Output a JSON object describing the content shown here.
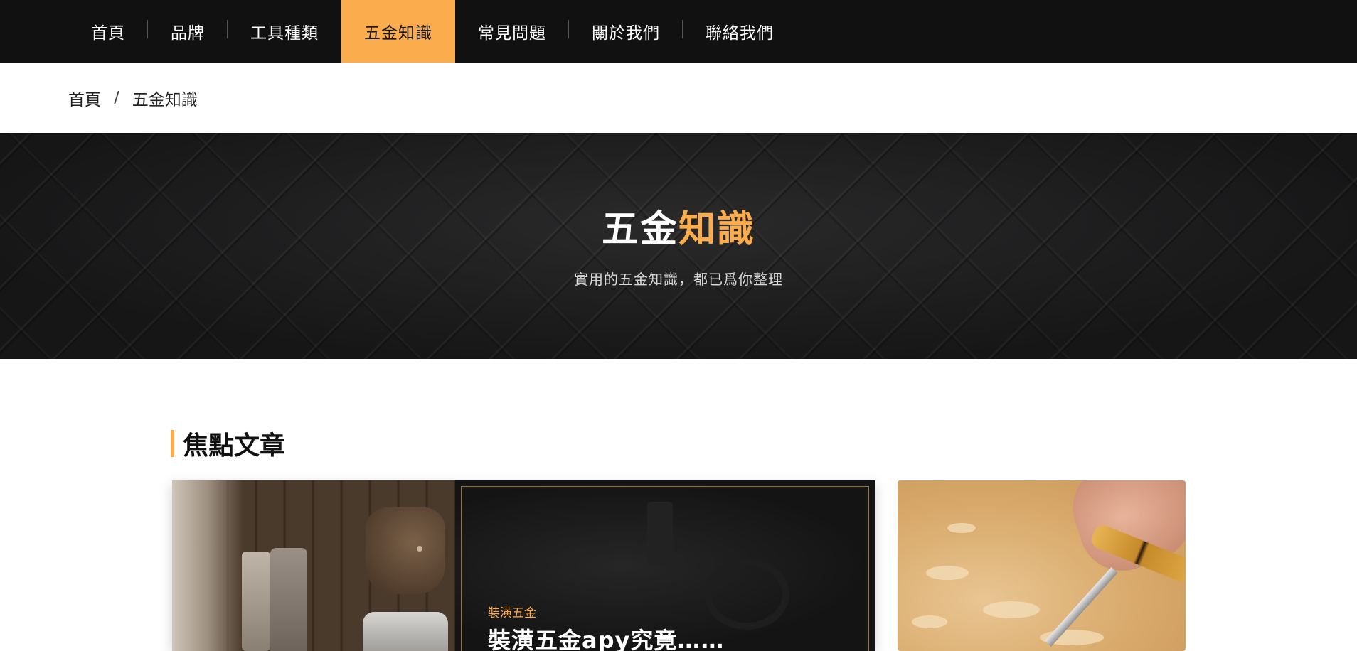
{
  "nav": {
    "items": [
      {
        "label": "首頁",
        "active": false
      },
      {
        "label": "品牌",
        "active": false
      },
      {
        "label": "工具種類",
        "active": false
      },
      {
        "label": "五金知識",
        "active": true
      },
      {
        "label": "常見問題",
        "active": false
      },
      {
        "label": "關於我們",
        "active": false
      },
      {
        "label": "聯絡我們",
        "active": false
      }
    ]
  },
  "breadcrumb": {
    "home": "首頁",
    "separator": "/",
    "current": "五金知識"
  },
  "hero": {
    "title_white": "五金",
    "title_orange": "知識",
    "subtitle": "實用的五金知識，都已爲你整理"
  },
  "featured": {
    "section_title": "焦點文章",
    "main_card": {
      "tag": "裝潢五金",
      "title": "裝潢五金ару究竟……"
    }
  },
  "colors": {
    "accent": "#fbac4c",
    "nav_bg": "#111111",
    "text_dark": "#222222"
  }
}
